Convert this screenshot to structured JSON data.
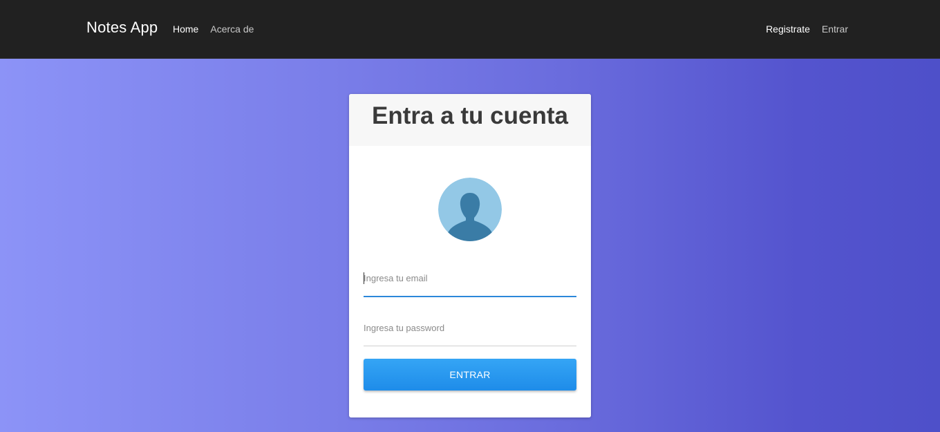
{
  "navbar": {
    "brand": "Notes App",
    "left_links": [
      {
        "label": "Home",
        "active": true
      },
      {
        "label": "Acerca de",
        "active": false
      }
    ],
    "right_links": [
      {
        "label": "Registrate",
        "active": true
      },
      {
        "label": "Entrar",
        "active": false
      }
    ]
  },
  "login_card": {
    "title": "Entra a tu cuenta",
    "avatar_icon": "user-avatar-icon",
    "email_field": {
      "placeholder": "Ingresa tu email",
      "value": ""
    },
    "password_field": {
      "placeholder": "Ingresa tu password",
      "value": ""
    },
    "submit_label": "ENTRAR"
  },
  "colors": {
    "navbar_bg": "#212121",
    "background_gradient_start": "#8c93f7",
    "background_gradient_end": "#4e50c9",
    "accent": "#2b87d9",
    "button": "#2196f3",
    "avatar_bg": "#93c8e6",
    "avatar_figure": "#3a7ca6"
  }
}
